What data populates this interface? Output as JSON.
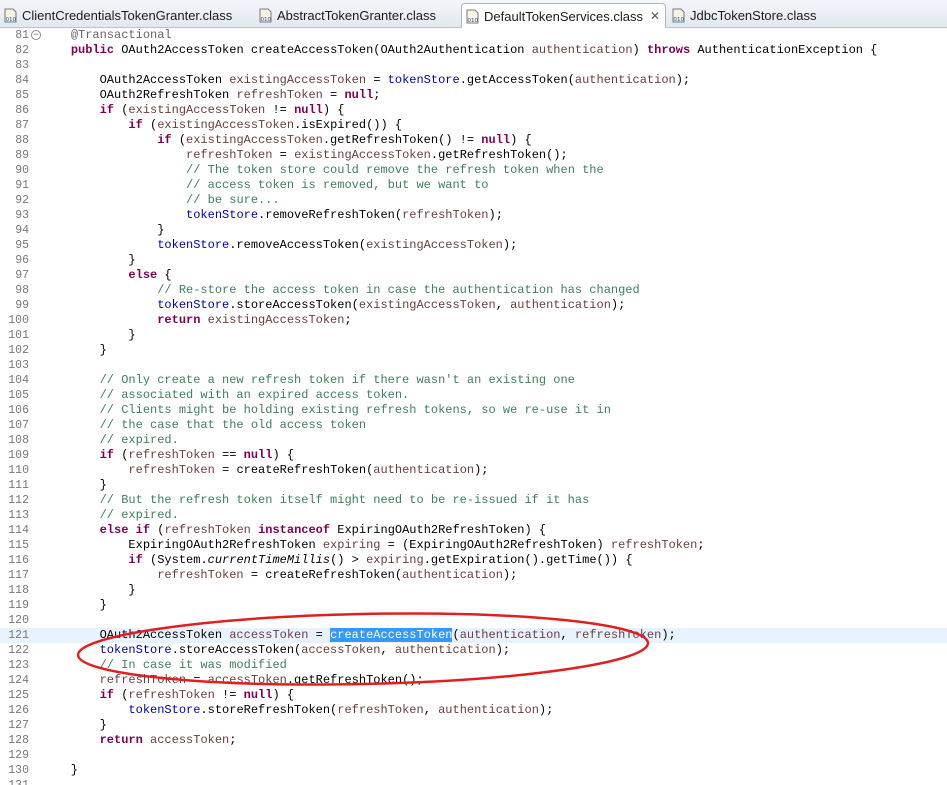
{
  "tabs": [
    {
      "label": "ClientCredentialsTokenGranter.class",
      "active": false,
      "closable": false
    },
    {
      "label": "AbstractTokenGranter.class",
      "active": false,
      "closable": false
    },
    {
      "label": "DefaultTokenServices.class",
      "active": true,
      "closable": true
    },
    {
      "label": "JdbcTokenStore.class",
      "active": false,
      "closable": false
    }
  ],
  "icons": {
    "tab_file": "class-file-icon",
    "close": "close-icon",
    "fold": "fold-collapse-icon"
  },
  "colors": {
    "keyword": "#7f0055",
    "comment": "#3f7f5f",
    "field": "#0000c0",
    "local": "#6a3e3e",
    "annotation": "#646464",
    "selection": "#3399ff",
    "highlight": "#e8f2fe",
    "ellipse": "#e02020"
  },
  "code": {
    "lines": [
      {
        "n": "81",
        "fold": true,
        "tokens": [
          {
            "t": "    "
          },
          {
            "t": "@Transactional",
            "c": "an"
          }
        ]
      },
      {
        "n": "82",
        "tokens": [
          {
            "t": "    "
          },
          {
            "t": "public",
            "c": "kw"
          },
          {
            "t": " OAuth2AccessToken createAccessToken(OAuth2Authentication "
          },
          {
            "t": "authentication",
            "c": "lv"
          },
          {
            "t": ") "
          },
          {
            "t": "throws",
            "c": "kw"
          },
          {
            "t": " AuthenticationException {"
          }
        ]
      },
      {
        "n": "83",
        "tokens": []
      },
      {
        "n": "84",
        "tokens": [
          {
            "t": "        OAuth2AccessToken "
          },
          {
            "t": "existingAccessToken",
            "c": "lv"
          },
          {
            "t": " = "
          },
          {
            "t": "tokenStore",
            "c": "fd"
          },
          {
            "t": ".getAccessToken("
          },
          {
            "t": "authentication",
            "c": "lv"
          },
          {
            "t": ");"
          }
        ]
      },
      {
        "n": "85",
        "tokens": [
          {
            "t": "        OAuth2RefreshToken "
          },
          {
            "t": "refreshToken",
            "c": "lv"
          },
          {
            "t": " = "
          },
          {
            "t": "null",
            "c": "kw"
          },
          {
            "t": ";"
          }
        ]
      },
      {
        "n": "86",
        "tokens": [
          {
            "t": "        "
          },
          {
            "t": "if",
            "c": "kw"
          },
          {
            "t": " ("
          },
          {
            "t": "existingAccessToken",
            "c": "lv"
          },
          {
            "t": " != "
          },
          {
            "t": "null",
            "c": "kw"
          },
          {
            "t": ") {"
          }
        ]
      },
      {
        "n": "87",
        "tokens": [
          {
            "t": "            "
          },
          {
            "t": "if",
            "c": "kw"
          },
          {
            "t": " ("
          },
          {
            "t": "existingAccessToken",
            "c": "lv"
          },
          {
            "t": ".isExpired()) {"
          }
        ]
      },
      {
        "n": "88",
        "tokens": [
          {
            "t": "                "
          },
          {
            "t": "if",
            "c": "kw"
          },
          {
            "t": " ("
          },
          {
            "t": "existingAccessToken",
            "c": "lv"
          },
          {
            "t": ".getRefreshToken() != "
          },
          {
            "t": "null",
            "c": "kw"
          },
          {
            "t": ") {"
          }
        ]
      },
      {
        "n": "89",
        "tokens": [
          {
            "t": "                    "
          },
          {
            "t": "refreshToken",
            "c": "lv"
          },
          {
            "t": " = "
          },
          {
            "t": "existingAccessToken",
            "c": "lv"
          },
          {
            "t": ".getRefreshToken();"
          }
        ]
      },
      {
        "n": "90",
        "tokens": [
          {
            "t": "                    "
          },
          {
            "t": "// The token store could remove the refresh token when the",
            "c": "cm"
          }
        ]
      },
      {
        "n": "91",
        "tokens": [
          {
            "t": "                    "
          },
          {
            "t": "// access token is removed, but we want to",
            "c": "cm"
          }
        ]
      },
      {
        "n": "92",
        "tokens": [
          {
            "t": "                    "
          },
          {
            "t": "// be sure...",
            "c": "cm"
          }
        ]
      },
      {
        "n": "93",
        "tokens": [
          {
            "t": "                    "
          },
          {
            "t": "tokenStore",
            "c": "fd"
          },
          {
            "t": ".removeRefreshToken("
          },
          {
            "t": "refreshToken",
            "c": "lv"
          },
          {
            "t": ");"
          }
        ]
      },
      {
        "n": "94",
        "tokens": [
          {
            "t": "                }"
          }
        ]
      },
      {
        "n": "95",
        "tokens": [
          {
            "t": "                "
          },
          {
            "t": "tokenStore",
            "c": "fd"
          },
          {
            "t": ".removeAccessToken("
          },
          {
            "t": "existingAccessToken",
            "c": "lv"
          },
          {
            "t": ");"
          }
        ]
      },
      {
        "n": "96",
        "tokens": [
          {
            "t": "            }"
          }
        ]
      },
      {
        "n": "97",
        "tokens": [
          {
            "t": "            "
          },
          {
            "t": "else",
            "c": "kw"
          },
          {
            "t": " {"
          }
        ]
      },
      {
        "n": "98",
        "tokens": [
          {
            "t": "                "
          },
          {
            "t": "// Re-store the access token in case the authentication has changed",
            "c": "cm"
          }
        ]
      },
      {
        "n": "99",
        "tokens": [
          {
            "t": "                "
          },
          {
            "t": "tokenStore",
            "c": "fd"
          },
          {
            "t": ".storeAccessToken("
          },
          {
            "t": "existingAccessToken",
            "c": "lv"
          },
          {
            "t": ", "
          },
          {
            "t": "authentication",
            "c": "lv"
          },
          {
            "t": ");"
          }
        ]
      },
      {
        "n": "100",
        "tokens": [
          {
            "t": "                "
          },
          {
            "t": "return",
            "c": "kw"
          },
          {
            "t": " "
          },
          {
            "t": "existingAccessToken",
            "c": "lv"
          },
          {
            "t": ";"
          }
        ]
      },
      {
        "n": "101",
        "tokens": [
          {
            "t": "            }"
          }
        ]
      },
      {
        "n": "102",
        "tokens": [
          {
            "t": "        }"
          }
        ]
      },
      {
        "n": "103",
        "tokens": []
      },
      {
        "n": "104",
        "tokens": [
          {
            "t": "        "
          },
          {
            "t": "// Only create a new refresh token if there wasn't an existing one",
            "c": "cm"
          }
        ]
      },
      {
        "n": "105",
        "tokens": [
          {
            "t": "        "
          },
          {
            "t": "// associated with an expired access token.",
            "c": "cm"
          }
        ]
      },
      {
        "n": "106",
        "tokens": [
          {
            "t": "        "
          },
          {
            "t": "// Clients might be holding existing refresh tokens, so we re-use it in",
            "c": "cm"
          }
        ]
      },
      {
        "n": "107",
        "tokens": [
          {
            "t": "        "
          },
          {
            "t": "// the case that the old access token",
            "c": "cm"
          }
        ]
      },
      {
        "n": "108",
        "tokens": [
          {
            "t": "        "
          },
          {
            "t": "// expired.",
            "c": "cm"
          }
        ]
      },
      {
        "n": "109",
        "tokens": [
          {
            "t": "        "
          },
          {
            "t": "if",
            "c": "kw"
          },
          {
            "t": " ("
          },
          {
            "t": "refreshToken",
            "c": "lv"
          },
          {
            "t": " == "
          },
          {
            "t": "null",
            "c": "kw"
          },
          {
            "t": ") {"
          }
        ]
      },
      {
        "n": "110",
        "tokens": [
          {
            "t": "            "
          },
          {
            "t": "refreshToken",
            "c": "lv"
          },
          {
            "t": " = createRefreshToken("
          },
          {
            "t": "authentication",
            "c": "lv"
          },
          {
            "t": ");"
          }
        ]
      },
      {
        "n": "111",
        "tokens": [
          {
            "t": "        }"
          }
        ]
      },
      {
        "n": "112",
        "tokens": [
          {
            "t": "        "
          },
          {
            "t": "// But the refresh token itself might need to be re-issued if it has",
            "c": "cm"
          }
        ]
      },
      {
        "n": "113",
        "tokens": [
          {
            "t": "        "
          },
          {
            "t": "// expired.",
            "c": "cm"
          }
        ]
      },
      {
        "n": "114",
        "tokens": [
          {
            "t": "        "
          },
          {
            "t": "else",
            "c": "kw"
          },
          {
            "t": " "
          },
          {
            "t": "if",
            "c": "kw"
          },
          {
            "t": " ("
          },
          {
            "t": "refreshToken",
            "c": "lv"
          },
          {
            "t": " "
          },
          {
            "t": "instanceof",
            "c": "kw"
          },
          {
            "t": " ExpiringOAuth2RefreshToken) {"
          }
        ]
      },
      {
        "n": "115",
        "tokens": [
          {
            "t": "            ExpiringOAuth2RefreshToken "
          },
          {
            "t": "expiring",
            "c": "lv"
          },
          {
            "t": " = (ExpiringOAuth2RefreshToken) "
          },
          {
            "t": "refreshToken",
            "c": "lv"
          },
          {
            "t": ";"
          }
        ]
      },
      {
        "n": "116",
        "tokens": [
          {
            "t": "            "
          },
          {
            "t": "if",
            "c": "kw"
          },
          {
            "t": " (System."
          },
          {
            "t": "currentTimeMillis",
            "c": "it"
          },
          {
            "t": "() > "
          },
          {
            "t": "expiring",
            "c": "lv"
          },
          {
            "t": ".getExpiration().getTime()) {"
          }
        ]
      },
      {
        "n": "117",
        "tokens": [
          {
            "t": "                "
          },
          {
            "t": "refreshToken",
            "c": "lv"
          },
          {
            "t": " = createRefreshToken("
          },
          {
            "t": "authentication",
            "c": "lv"
          },
          {
            "t": ");"
          }
        ]
      },
      {
        "n": "118",
        "tokens": [
          {
            "t": "            }"
          }
        ]
      },
      {
        "n": "119",
        "tokens": [
          {
            "t": "        }"
          }
        ]
      },
      {
        "n": "120",
        "tokens": []
      },
      {
        "n": "121",
        "highlight": true,
        "tokens": [
          {
            "t": "        OAuth2AccessToken "
          },
          {
            "t": "accessToken",
            "c": "lv"
          },
          {
            "t": " = "
          },
          {
            "t": "createAccessToken",
            "c": "sel"
          },
          {
            "t": "("
          },
          {
            "t": "authentication",
            "c": "lv"
          },
          {
            "t": ", "
          },
          {
            "t": "refreshToken",
            "c": "lv"
          },
          {
            "t": ");"
          }
        ]
      },
      {
        "n": "122",
        "tokens": [
          {
            "t": "        "
          },
          {
            "t": "tokenStore",
            "c": "fd"
          },
          {
            "t": ".storeAccessToken("
          },
          {
            "t": "accessToken",
            "c": "lv"
          },
          {
            "t": ", "
          },
          {
            "t": "authentication",
            "c": "lv"
          },
          {
            "t": ");"
          }
        ]
      },
      {
        "n": "123",
        "tokens": [
          {
            "t": "        "
          },
          {
            "t": "// In case it was modified",
            "c": "cm"
          }
        ]
      },
      {
        "n": "124",
        "tokens": [
          {
            "t": "        "
          },
          {
            "t": "refreshToken",
            "c": "lv"
          },
          {
            "t": " = "
          },
          {
            "t": "accessToken",
            "c": "lv"
          },
          {
            "t": ".getRefreshToken();"
          }
        ]
      },
      {
        "n": "125",
        "tokens": [
          {
            "t": "        "
          },
          {
            "t": "if",
            "c": "kw"
          },
          {
            "t": " ("
          },
          {
            "t": "refreshToken",
            "c": "lv"
          },
          {
            "t": " != "
          },
          {
            "t": "null",
            "c": "kw"
          },
          {
            "t": ") {"
          }
        ]
      },
      {
        "n": "126",
        "tokens": [
          {
            "t": "            "
          },
          {
            "t": "tokenStore",
            "c": "fd"
          },
          {
            "t": ".storeRefreshToken("
          },
          {
            "t": "refreshToken",
            "c": "lv"
          },
          {
            "t": ", "
          },
          {
            "t": "authentication",
            "c": "lv"
          },
          {
            "t": ");"
          }
        ]
      },
      {
        "n": "127",
        "tokens": [
          {
            "t": "        }"
          }
        ]
      },
      {
        "n": "128",
        "tokens": [
          {
            "t": "        "
          },
          {
            "t": "return",
            "c": "kw"
          },
          {
            "t": " "
          },
          {
            "t": "accessToken",
            "c": "lv"
          },
          {
            "t": ";"
          }
        ]
      },
      {
        "n": "129",
        "tokens": []
      },
      {
        "n": "130",
        "tokens": [
          {
            "t": "    }"
          }
        ]
      },
      {
        "n": "131",
        "tokens": []
      }
    ]
  }
}
